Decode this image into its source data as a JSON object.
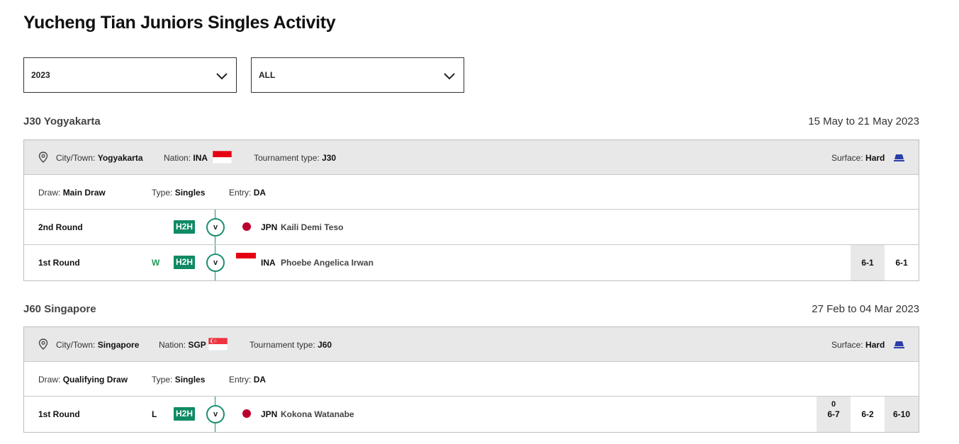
{
  "page": {
    "title": "Yucheng Tian Juniors Singles Activity"
  },
  "filters": {
    "year": {
      "value": "2023",
      "icon": "chevron-down-icon"
    },
    "type": {
      "value": "ALL",
      "icon": "chevron-down-icon"
    }
  },
  "tournaments": [
    {
      "name": "J30 Yogyakarta",
      "dates": "15 May to 21 May 2023",
      "city_label": "City/Town:",
      "city": "Yogyakarta",
      "nation_label": "Nation:",
      "nation": "INA",
      "nation_flag": "flag-indonesia-icon",
      "ttype_label": "Tournament type:",
      "ttype": "J30",
      "surface_label": "Surface:",
      "surface": "Hard",
      "draw_label": "Draw:",
      "draw": "Main Draw",
      "type_label": "Type:",
      "type": "Singles",
      "entry_label": "Entry:",
      "entry": "DA",
      "matches": [
        {
          "round": "2nd Round",
          "result": "",
          "h2h": "H2H",
          "vs": "v",
          "opp_nat": "JPN",
          "opp_name": "Kaili Demi Teso",
          "scores": []
        },
        {
          "round": "1st Round",
          "result": "W",
          "h2h": "H2H",
          "vs": "v",
          "opp_nat": "INA",
          "opp_name": "Phoebe Angelica Irwan",
          "scores": [
            "6-1",
            "6-1"
          ]
        }
      ]
    },
    {
      "name": "J60 Singapore",
      "dates": "27 Feb to 04 Mar 2023",
      "city_label": "City/Town:",
      "city": "Singapore",
      "nation_label": "Nation:",
      "nation": "SGP",
      "nation_flag": "flag-singapore-icon",
      "ttype_label": "Tournament type:",
      "ttype": "J60",
      "surface_label": "Surface:",
      "surface": "Hard",
      "draw_label": "Draw:",
      "draw": "Qualifying Draw",
      "type_label": "Type:",
      "type": "Singles",
      "entry_label": "Entry:",
      "entry": "DA",
      "matches": [
        {
          "round": "1st Round",
          "result": "L",
          "h2h": "H2H",
          "vs": "v",
          "opp_nat": "JPN",
          "opp_name": "Kokona Watanabe",
          "scores": [
            "6-7",
            "6-2",
            "6-10"
          ],
          "tiebreak": "0"
        }
      ]
    }
  ],
  "colors": {
    "h2h_green": "#0f8a65",
    "win_green": "#1f9b55",
    "surface_blue": "#2b3fa8",
    "info_bg": "#e8e8e8"
  }
}
